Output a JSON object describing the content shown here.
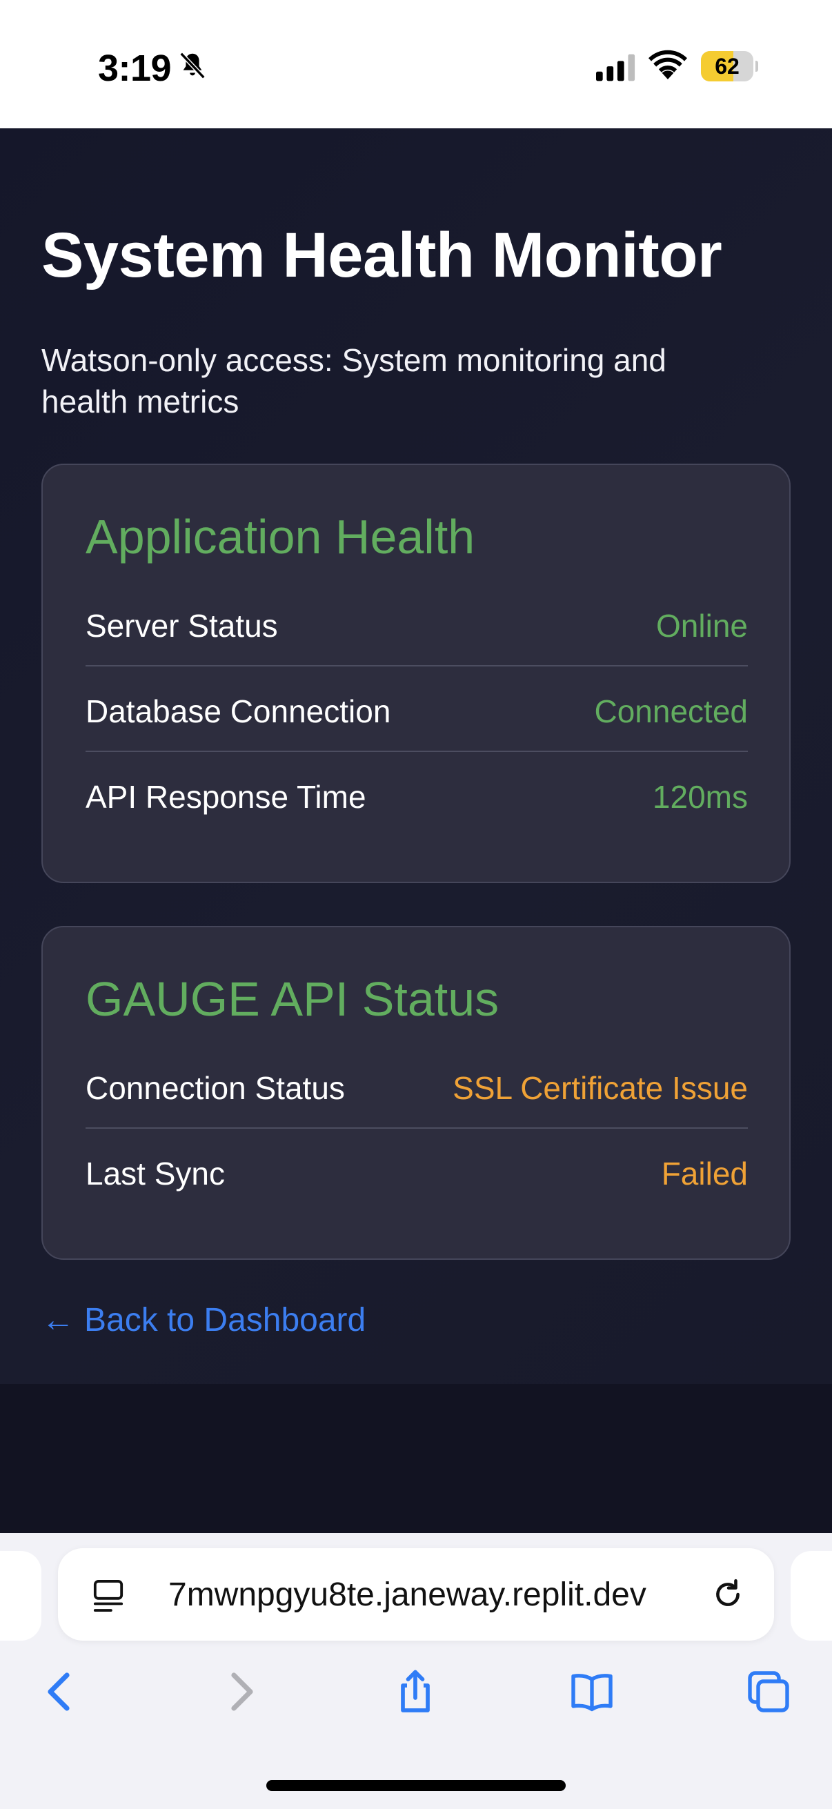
{
  "status_bar": {
    "time": "3:19",
    "battery_level": "62",
    "battery_fraction": 0.62,
    "icons": [
      "bell-slash-icon",
      "cellular-signal-icon",
      "wifi-icon",
      "battery-icon"
    ]
  },
  "page": {
    "title": "System Health Monitor",
    "subtitle": "Watson-only access: System monitoring and health metrics"
  },
  "cards": [
    {
      "title": "Application Health",
      "rows": [
        {
          "label": "Server Status",
          "value": "Online",
          "status_color": "#62ad5f"
        },
        {
          "label": "Database Connection",
          "value": "Connected",
          "status_color": "#62ad5f"
        },
        {
          "label": "API Response Time",
          "value": "120ms",
          "status_color": "#62ad5f"
        }
      ]
    },
    {
      "title": "GAUGE API Status",
      "rows": [
        {
          "label": "Connection Status",
          "value": "SSL Certificate Issue",
          "status_color": "#f0a236"
        },
        {
          "label": "Last Sync",
          "value": "Failed",
          "status_color": "#f0a236"
        }
      ]
    }
  ],
  "back_link": {
    "arrow": "←",
    "label": "Back to Dashboard"
  },
  "browser": {
    "url": "7mwnpgyu8te.janeway.replit.dev",
    "toolbar_icons": [
      "back-icon",
      "forward-icon",
      "share-icon",
      "bookmarks-icon",
      "tabs-icon"
    ]
  },
  "colors": {
    "accent_green": "#62ad5f",
    "warning_orange": "#f0a236",
    "link_blue": "#3c7ef0",
    "card_bg": "#2d2d3e",
    "page_bg": "#15172a"
  }
}
